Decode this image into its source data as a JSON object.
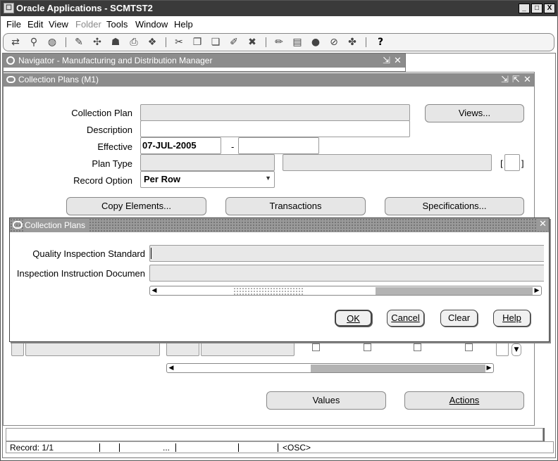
{
  "app": {
    "title": "Oracle Applications - SCMTST2",
    "window_buttons": [
      "_",
      "□",
      "X"
    ]
  },
  "menu": {
    "file": "File",
    "edit": "Edit",
    "view": "View",
    "folder": "Folder",
    "tools": "Tools",
    "window": "Window",
    "help": "Help"
  },
  "toolbar": {
    "help_glyph": "?"
  },
  "navigator": {
    "title": "Navigator - Manufacturing and Distribution Manager"
  },
  "collection_plans_form": {
    "title": "Collection Plans (M1)",
    "labels": {
      "collection_plan": "Collection Plan",
      "description": "Description",
      "effective": "Effective",
      "plan_type": "Plan Type",
      "record_option": "Record Option"
    },
    "values": {
      "effective_from": "07-JUL-2005",
      "effective_dash": "-",
      "record_option": "Per Row",
      "bracket_open": "[",
      "bracket_close": "]"
    },
    "buttons": {
      "views": "Views...",
      "copy_elements": "Copy Elements...",
      "transactions": "Transactions",
      "specifications": "Specifications...",
      "values": "Values",
      "actions": "Actions"
    }
  },
  "dialog": {
    "title": "Collection Plans",
    "labels": {
      "quality_standard": "Quality Inspection Standard",
      "instruction_document": "Inspection Instruction Documen"
    },
    "buttons": {
      "ok": "OK",
      "cancel": "Cancel",
      "clear": "Clear",
      "help": "Help"
    }
  },
  "status_bar": {
    "record": "Record: 1/1",
    "ellipsis": "...",
    "osc": "<OSC>"
  }
}
